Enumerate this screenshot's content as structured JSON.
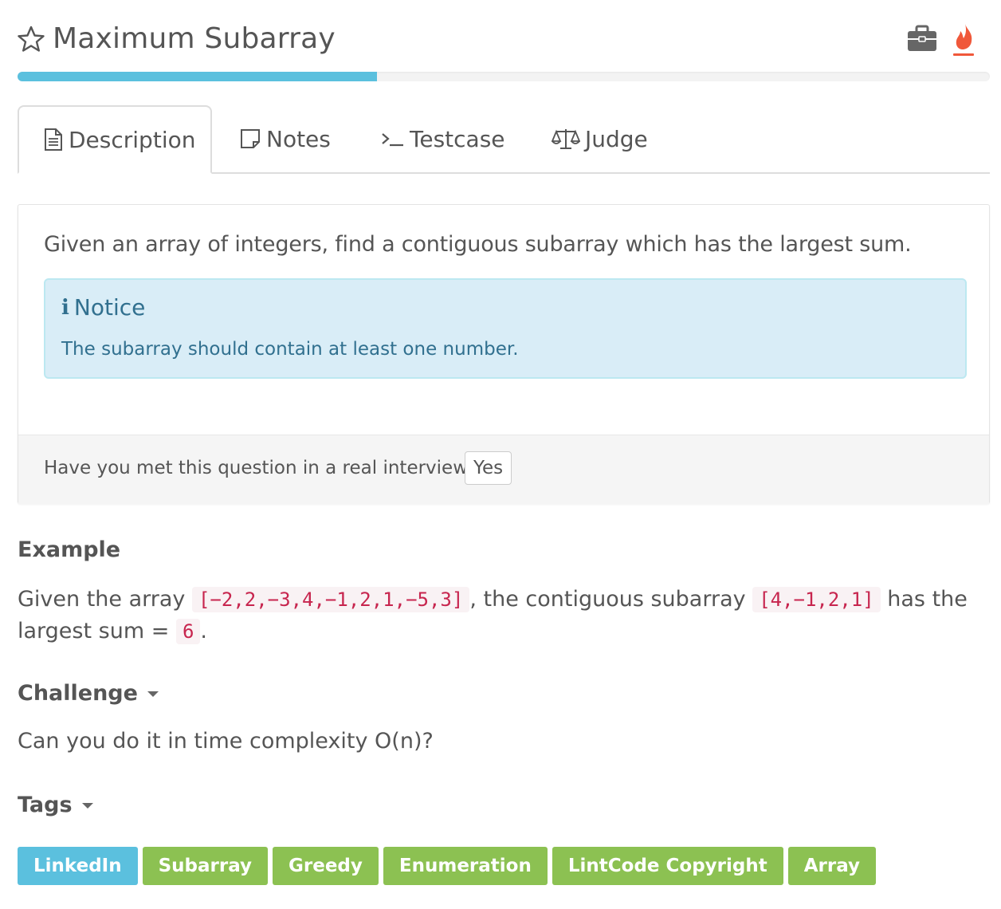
{
  "header": {
    "title": "Maximum Subarray"
  },
  "progress": {
    "fraction": 0.37,
    "color": "#5bc0de"
  },
  "tabs": [
    {
      "label": "Description",
      "icon": "document-icon",
      "active": true
    },
    {
      "label": "Notes",
      "icon": "note-icon",
      "active": false
    },
    {
      "label": "Testcase",
      "icon": "terminal-icon",
      "active": false
    },
    {
      "label": "Judge",
      "icon": "balance-scale-icon",
      "active": false
    }
  ],
  "description": {
    "text": "Given an array of integers, find a contiguous subarray which has the largest sum."
  },
  "notice": {
    "title": "Notice",
    "text": "The subarray should contain at least one number."
  },
  "interview": {
    "question": "Have you met this question in a real interview?",
    "yes_label": "Yes"
  },
  "example": {
    "heading": "Example",
    "text_before": "Given the array ",
    "code1": "[−2,2,−3,4,−1,2,1,−5,3]",
    "text_middle": ", the contiguous subarray ",
    "code2": "[4,−1,2,1]",
    "text_after": " has the largest sum = ",
    "code3": "6",
    "text_end": "."
  },
  "challenge": {
    "heading": "Challenge",
    "text": "Can you do it in time complexity O(n)?"
  },
  "tags_section": {
    "heading": "Tags",
    "tags": [
      {
        "label": "LinkedIn",
        "color": "#5bc0de"
      },
      {
        "label": "Subarray",
        "color": "#8cc152"
      },
      {
        "label": "Greedy",
        "color": "#8cc152"
      },
      {
        "label": "Enumeration",
        "color": "#8cc152"
      },
      {
        "label": "LintCode Copyright",
        "color": "#8cc152"
      },
      {
        "label": "Array",
        "color": "#8cc152"
      }
    ]
  },
  "colors": {
    "flame": "#f0583a",
    "briefcase": "#666666",
    "notice_bg": "#d9edf7",
    "notice_text": "#31708f"
  }
}
